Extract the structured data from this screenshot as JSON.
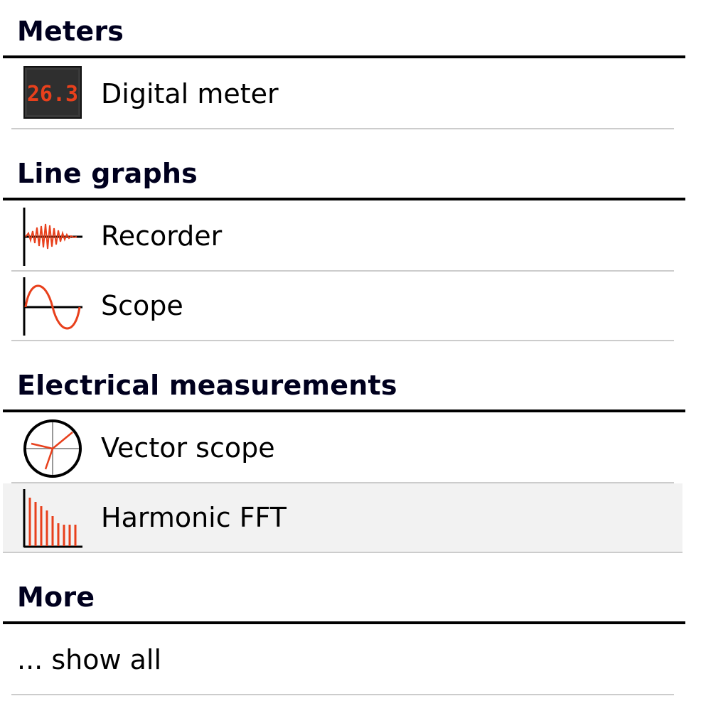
{
  "sections": [
    {
      "title": "Meters",
      "items": [
        {
          "label": "Digital meter",
          "icon": "digital-meter-icon",
          "icon_text": "26.3"
        }
      ]
    },
    {
      "title": "Line graphs",
      "items": [
        {
          "label": "Recorder",
          "icon": "recorder-waveform-icon"
        },
        {
          "label": "Scope",
          "icon": "scope-sine-wave-icon"
        }
      ]
    },
    {
      "title": "Electrical measurements",
      "items": [
        {
          "label": "Vector scope",
          "icon": "vector-scope-icon"
        },
        {
          "label": "Harmonic FFT",
          "icon": "harmonic-fft-bars-icon",
          "highlighted": true
        }
      ]
    },
    {
      "title": "More",
      "items": [
        {
          "label": "... show all"
        }
      ]
    }
  ],
  "colors": {
    "accent": "#e8401c",
    "header_text": "#00001e",
    "divider": "#cccccc",
    "highlight_bg": "#f2f2f2"
  }
}
